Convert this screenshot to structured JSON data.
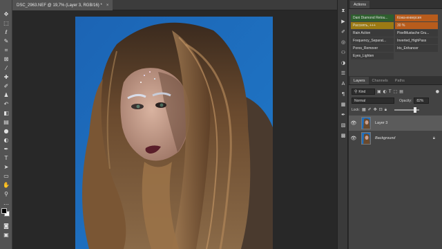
{
  "document_tab": {
    "title": "DSC_2963.NEF @ 19,7% (Layer 3, RGB/16) *",
    "close": "×"
  },
  "toolbar": {
    "tools": [
      {
        "name": "move-tool",
        "glyph": "✥"
      },
      {
        "name": "marquee-tool",
        "glyph": "⬚"
      },
      {
        "name": "lasso-tool",
        "glyph": "ℓ"
      },
      {
        "name": "quick-select-tool",
        "glyph": "✎"
      },
      {
        "name": "crop-tool",
        "glyph": "⌗"
      },
      {
        "name": "frame-tool",
        "glyph": "⊠"
      },
      {
        "name": "eyedropper-tool",
        "glyph": "⁄"
      },
      {
        "name": "healing-brush-tool",
        "glyph": "✚"
      },
      {
        "name": "brush-tool",
        "glyph": "✐"
      },
      {
        "name": "clone-stamp-tool",
        "glyph": "♟"
      },
      {
        "name": "history-brush-tool",
        "glyph": "↶"
      },
      {
        "name": "eraser-tool",
        "glyph": "◧"
      },
      {
        "name": "gradient-tool",
        "glyph": "▤"
      },
      {
        "name": "blur-tool",
        "glyph": "●"
      },
      {
        "name": "dodge-tool",
        "glyph": "◐"
      },
      {
        "name": "pen-tool",
        "glyph": "✒"
      },
      {
        "name": "type-tool",
        "glyph": "T"
      },
      {
        "name": "path-select-tool",
        "glyph": "➤"
      },
      {
        "name": "rectangle-tool",
        "glyph": "▭"
      },
      {
        "name": "hand-tool",
        "glyph": "✋"
      },
      {
        "name": "zoom-tool",
        "glyph": "⚲"
      },
      {
        "name": "more-tools",
        "glyph": "…"
      }
    ],
    "bottom": [
      {
        "name": "quick-mask-icon",
        "glyph": "◙"
      },
      {
        "name": "screen-mode-icon",
        "glyph": "▣"
      }
    ]
  },
  "iconstrip": [
    {
      "name": "history-icon",
      "glyph": "⧗"
    },
    {
      "name": "actions-icon",
      "glyph": "▶"
    },
    {
      "name": "brush-settings-icon",
      "glyph": "✐"
    },
    {
      "name": "clone-source-icon",
      "glyph": "◎"
    },
    {
      "name": "libraries-icon",
      "glyph": "⚇"
    },
    {
      "name": "adjustments-icon",
      "glyph": "◑"
    },
    {
      "name": "properties-icon",
      "glyph": "☰"
    },
    {
      "name": "character-icon",
      "glyph": "A"
    },
    {
      "name": "paragraph-icon",
      "glyph": "¶"
    },
    {
      "name": "glyphs-icon",
      "glyph": "▦"
    },
    {
      "name": "paths-icon",
      "glyph": "✒"
    },
    {
      "name": "styles-icon",
      "glyph": "▧"
    },
    {
      "name": "swatches-icon",
      "glyph": "▩"
    }
  ],
  "actions_panel": {
    "tab": "Actions",
    "buttons": [
      {
        "label": "Dani Diamond Retou...",
        "color": "#2e5f2e"
      },
      {
        "label": "Кожа-инверсия",
        "color": "#b85c1c"
      },
      {
        "label": "Рассеять, +++",
        "color": "#9b7a14"
      },
      {
        "label": "30 %",
        "color": "#b85c1c"
      },
      {
        "label": "Rain Action",
        "color": "#3a3a3a"
      },
      {
        "label": "PixelMustache Gru...",
        "color": "#3a3a3a"
      },
      {
        "label": "Frequency_Separat...",
        "color": "#3a3a3a"
      },
      {
        "label": "Inverted_HighPass",
        "color": "#3a3a3a"
      },
      {
        "label": "Pores_Remover",
        "color": "#3a3a3a"
      },
      {
        "label": "Iris_Enhancer",
        "color": "#3a3a3a"
      },
      {
        "label": "Eyes_Lighten",
        "color": "#3a3a3a"
      }
    ]
  },
  "layers_panel": {
    "tabs": [
      "Layers",
      "Channels",
      "Paths"
    ],
    "filter_label": "Kind",
    "blend_mode": "Normal",
    "opacity_label": "Opacity:",
    "opacity_value": "82%",
    "lock_label": "Lock:",
    "layers": [
      {
        "name": "Layer 3",
        "visible": true,
        "selected": true,
        "italic": false,
        "locked": false
      },
      {
        "name": "Background",
        "visible": true,
        "selected": false,
        "italic": true,
        "locked": true
      }
    ]
  },
  "colors": {
    "photo_background": "#1f6fbe",
    "panel_bg": "#434343",
    "toolbar_bg": "#535353",
    "selected_layer_bg": "#5b5b5b"
  }
}
